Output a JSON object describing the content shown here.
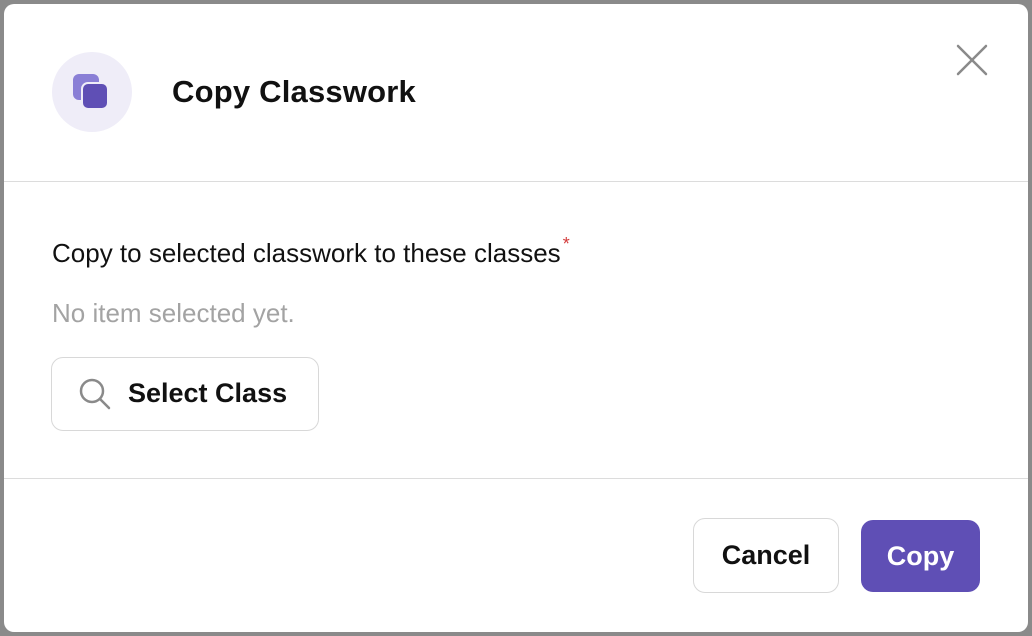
{
  "dialog": {
    "title": "Copy Classwork",
    "header_icon": "copy-icon",
    "close_icon": "close-icon",
    "accent_color": "#5f4fb5",
    "icon_bg_color": "#efedf8"
  },
  "form": {
    "label": "Copy to selected classwork to these classes",
    "required_marker": "*",
    "empty_hint": "No item selected yet.",
    "select_button_label": "Select Class",
    "select_button_icon": "search-icon"
  },
  "footer": {
    "cancel_label": "Cancel",
    "copy_label": "Copy"
  }
}
